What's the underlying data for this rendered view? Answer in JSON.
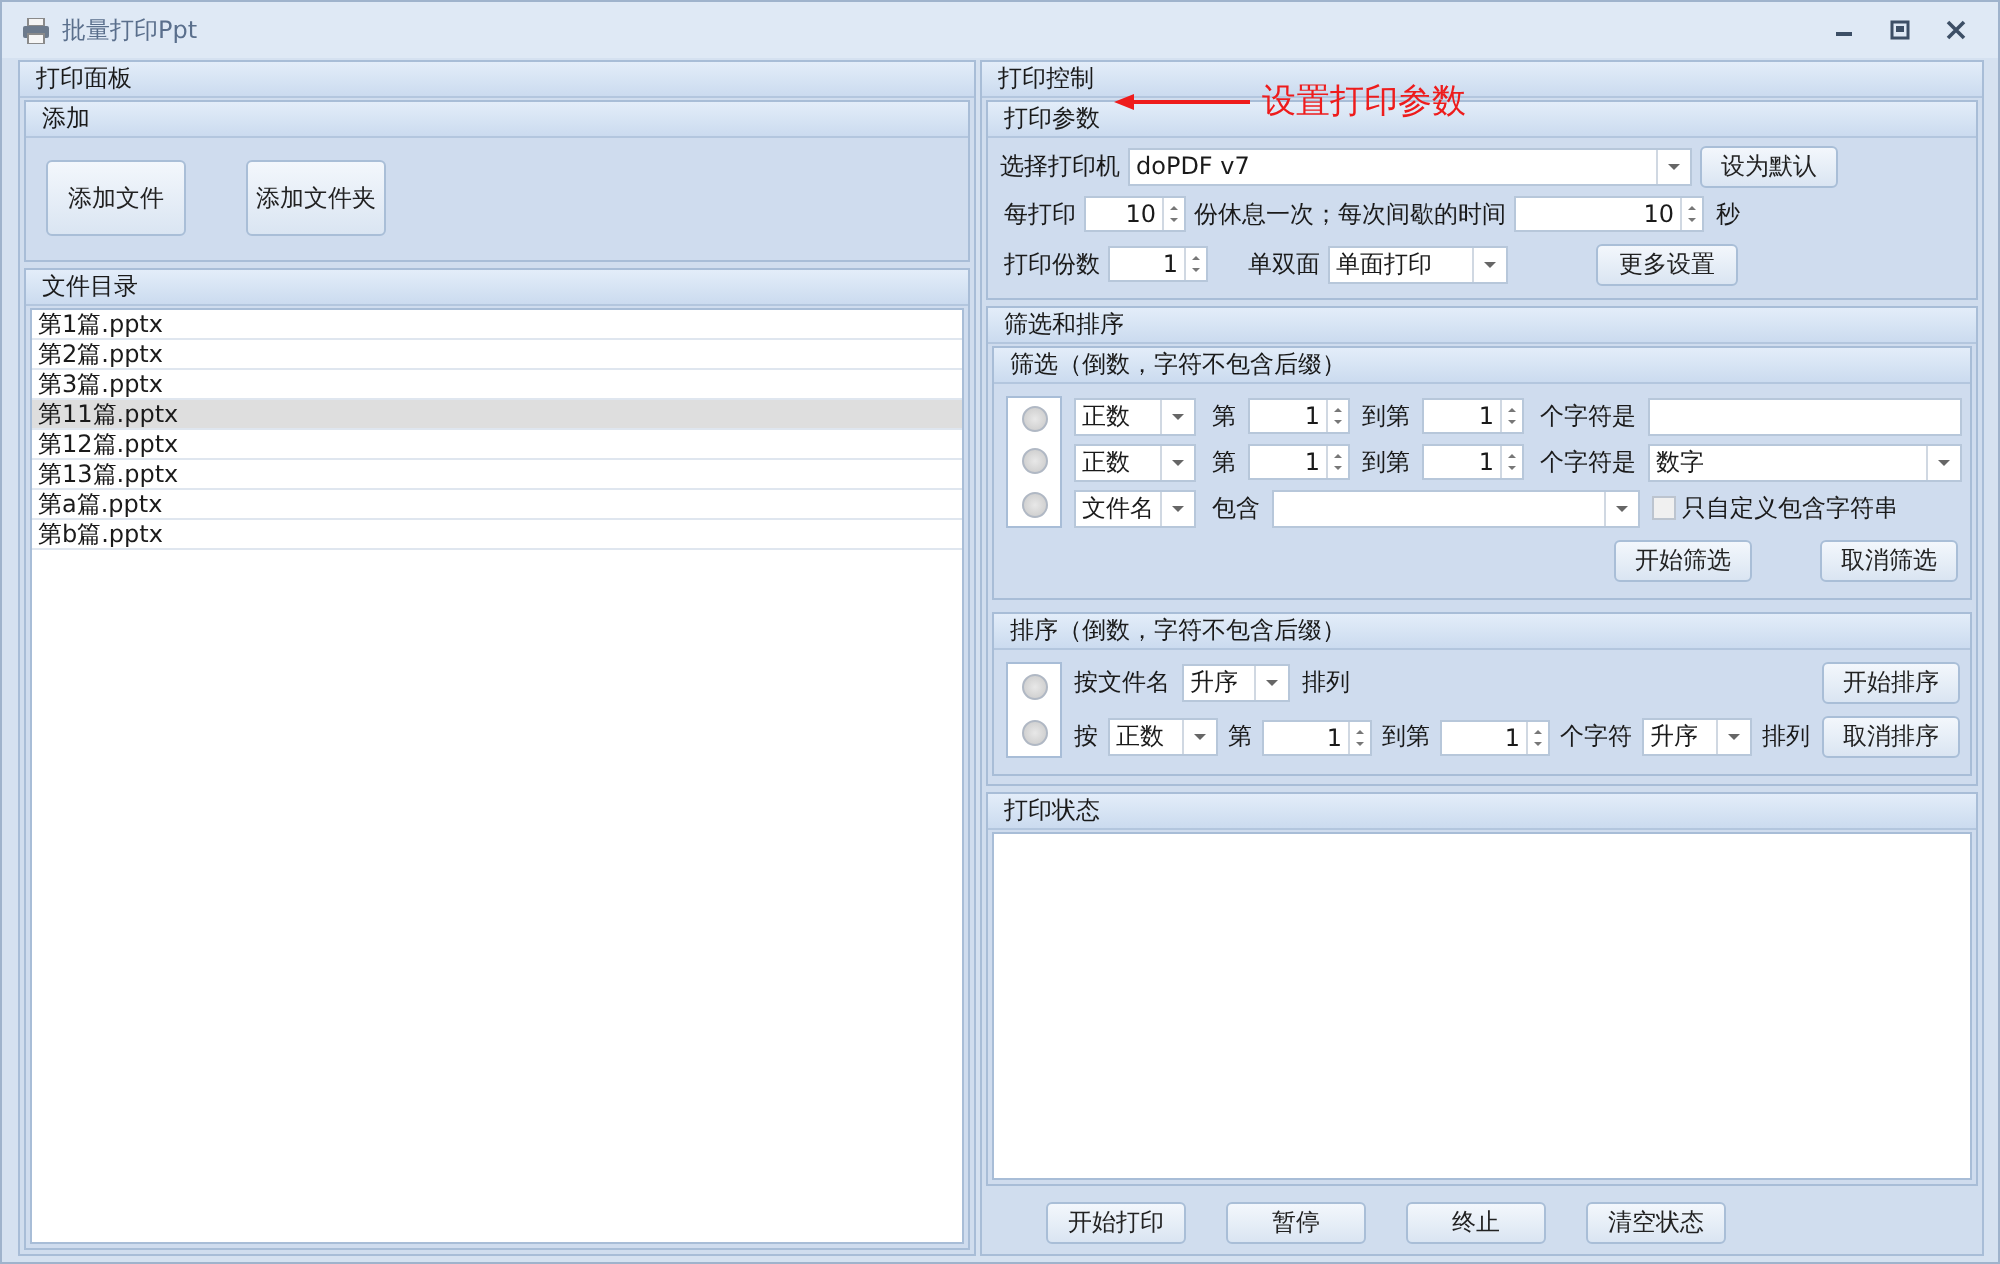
{
  "window": {
    "title": "批量打印Ppt"
  },
  "annotation": {
    "text": "设置打印参数"
  },
  "print_panel": {
    "title": "打印面板",
    "add_section": {
      "title": "添加",
      "buttons": [
        "添加文件",
        "添加文件夹"
      ]
    },
    "file_list": {
      "title": "文件目录",
      "items": [
        {
          "name": "第1篇.pptx",
          "selected": false
        },
        {
          "name": "第2篇.pptx",
          "selected": false
        },
        {
          "name": "第3篇.pptx",
          "selected": false
        },
        {
          "name": "第11篇.pptx",
          "selected": true
        },
        {
          "name": "第12篇.pptx",
          "selected": false
        },
        {
          "name": "第13篇.pptx",
          "selected": false
        },
        {
          "name": "第a篇.pptx",
          "selected": false
        },
        {
          "name": "第b篇.pptx",
          "selected": false
        }
      ]
    }
  },
  "print_control": {
    "title": "打印控制",
    "params": {
      "title": "打印参数",
      "printer_label": "选择打印机",
      "printer": "doPDF v7",
      "set_default": "设为默认",
      "every_label": "每打印",
      "every_value": "10",
      "rest_label": "份休息一次；每次间歇的时间",
      "interval_value": "10",
      "seconds": "秒",
      "copies_label": "打印份数",
      "copies_value": "1",
      "duplex_label": "单双面",
      "duplex_value": "单面打印",
      "more": "更多设置"
    },
    "filter_sort": {
      "title": "筛选和排序",
      "filter": {
        "title": "筛选（倒数，字符不包含后缀）",
        "rows": [
          {
            "kind": "range",
            "selected": false,
            "mode": "正数",
            "from_label": "第",
            "from": "1",
            "to_label": "到第",
            "to": "1",
            "is_label": "个字符是",
            "field": {
              "kind": "text"
            }
          },
          {
            "kind": "range",
            "selected": false,
            "mode": "正数",
            "from_label": "第",
            "from": "1",
            "to_label": "到第",
            "to": "1",
            "is_label": "个字符是",
            "field": {
              "kind": "dropdown",
              "value": "数字"
            }
          },
          {
            "kind": "contains",
            "selected": false,
            "mode": "文件名",
            "contains_label": "包含",
            "checkbox": {
              "label": "只自定义包含字符串",
              "checked": false
            }
          }
        ],
        "start": "开始筛选",
        "cancel": "取消筛选"
      },
      "sort": {
        "title": "排序（倒数，字符不包含后缀）",
        "rows": [
          {
            "kind": "by_name",
            "selected": false,
            "label": "按文件名",
            "order": "升序",
            "suffix": "排列"
          },
          {
            "kind": "by_range",
            "selected": false,
            "label": "按",
            "mode": "正数",
            "from_label": "第",
            "from": "1",
            "to_label": "到第",
            "to": "1",
            "chars_label": "个字符",
            "order": "升序",
            "suffix": "排列"
          }
        ],
        "start": "开始排序",
        "cancel": "取消排序"
      }
    },
    "status": {
      "title": "打印状态"
    },
    "buttons": [
      "开始打印",
      "暂停",
      "终止",
      "清空状态"
    ]
  }
}
